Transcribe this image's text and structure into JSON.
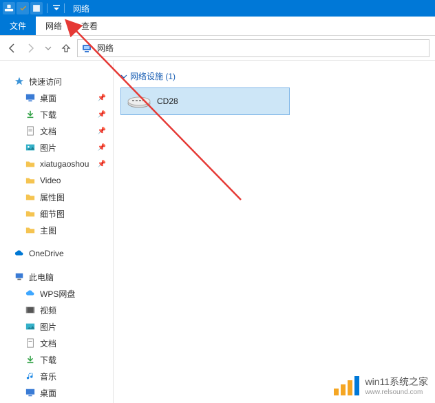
{
  "title": "网络",
  "ribbon": {
    "file": "文件",
    "network": "网络",
    "view": "查看"
  },
  "address": {
    "text": "网络"
  },
  "sidebar": {
    "quick_access": "快速访问",
    "quick_items": [
      {
        "label": "桌面",
        "pinned": true,
        "icon": "desktop"
      },
      {
        "label": "下载",
        "pinned": true,
        "icon": "download"
      },
      {
        "label": "文档",
        "pinned": true,
        "icon": "document"
      },
      {
        "label": "图片",
        "pinned": true,
        "icon": "pictures"
      },
      {
        "label": "xiatugaoshou",
        "pinned": true,
        "icon": "folder"
      },
      {
        "label": "Video",
        "pinned": false,
        "icon": "folder"
      },
      {
        "label": "属性图",
        "pinned": false,
        "icon": "folder"
      },
      {
        "label": "细节图",
        "pinned": false,
        "icon": "folder"
      },
      {
        "label": "主图",
        "pinned": false,
        "icon": "folder"
      }
    ],
    "onedrive": "OneDrive",
    "this_pc": "此电脑",
    "pc_items": [
      {
        "label": "WPS网盘",
        "icon": "cloud"
      },
      {
        "label": "视频",
        "icon": "video"
      },
      {
        "label": "图片",
        "icon": "pictures"
      },
      {
        "label": "文档",
        "icon": "document"
      },
      {
        "label": "下载",
        "icon": "download"
      },
      {
        "label": "音乐",
        "icon": "music"
      },
      {
        "label": "桌面",
        "icon": "desktop"
      }
    ]
  },
  "content": {
    "group_label": "网络设施 (1)",
    "item_label": "CD28"
  },
  "watermark": {
    "main": "win11系统之家",
    "sub": "www.relsound.com"
  }
}
